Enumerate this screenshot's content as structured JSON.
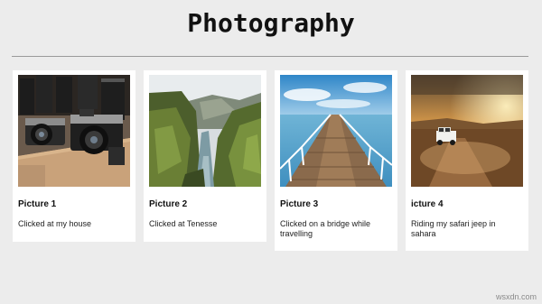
{
  "header": {
    "title": "Photography"
  },
  "cards": [
    {
      "title": "Picture 1",
      "text": "Clicked at my house",
      "image": "vintage-cameras-photo"
    },
    {
      "title": "Picture 2",
      "text": "Clicked at Tenesse",
      "image": "mossy-canyon-photo"
    },
    {
      "title": "Picture 3",
      "text": "Clicked on a bridge while travelling",
      "image": "wooden-pier-photo"
    },
    {
      "title": "icture 4",
      "text": "Riding my safari jeep in sahara",
      "image": "desert-jeep-photo"
    }
  ],
  "watermark": "wsxdn.com",
  "colors": {
    "background": "#ececec",
    "card": "#ffffff",
    "divider": "#9a9a9a"
  }
}
